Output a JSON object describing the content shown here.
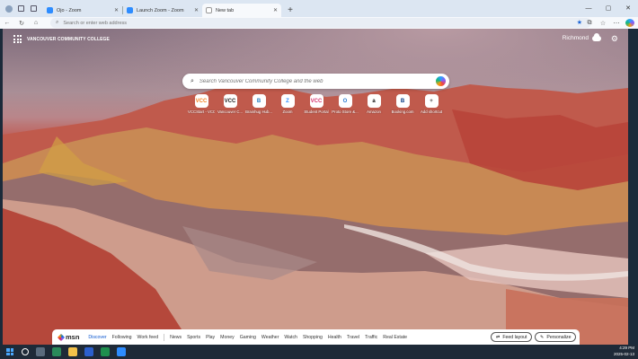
{
  "browser": {
    "tabs": [
      {
        "label": "Ojo - Zoom",
        "favicon": "zoom-icon"
      },
      {
        "label": "Launch Zoom - Zoom",
        "favicon": "zoom-icon"
      },
      {
        "label": "New tab",
        "favicon": "edge-icon",
        "active": true
      }
    ],
    "address_placeholder": "Search or enter web address"
  },
  "newtab": {
    "org_name": "VANCOUVER COMMUNITY COLLEGE",
    "weather_location": "Richmond",
    "search_placeholder": "Search Vancouver Community College and the web",
    "shortcuts": [
      {
        "label": "VCCStart - VCC",
        "glyph": "VCC",
        "color": "#f58220"
      },
      {
        "label": "Vancouver C...",
        "glyph": "VCC",
        "color": "#222222"
      },
      {
        "label": "Brainhug Hub...",
        "glyph": "B",
        "color": "#1f7abf"
      },
      {
        "label": "Zoom",
        "glyph": "Z",
        "color": "#2d8cff"
      },
      {
        "label": "Student Portal",
        "glyph": "VCC",
        "color": "#d6336c"
      },
      {
        "label": "Proto Store &...",
        "glyph": "O",
        "color": "#2b7cd3"
      },
      {
        "label": "Amazon",
        "glyph": "a",
        "color": "#111111"
      },
      {
        "label": "Booking.com",
        "glyph": "B",
        "color": "#003580"
      },
      {
        "label": "Add shortcut",
        "glyph": "+",
        "color": "#444444"
      }
    ]
  },
  "feed": {
    "brand": "msn",
    "tabs": [
      "Discover",
      "Following",
      "Work feed"
    ],
    "categories": [
      "News",
      "Sports",
      "Play",
      "Money",
      "Gaming",
      "Weather",
      "Watch",
      "Shopping",
      "Health",
      "Travel",
      "Traffic",
      "Real Estate"
    ],
    "feed_layout_label": "Feed layout",
    "personalize_label": "Personalize"
  },
  "taskbar": {
    "time": "4:29 PM",
    "date": "2025-02-13"
  }
}
